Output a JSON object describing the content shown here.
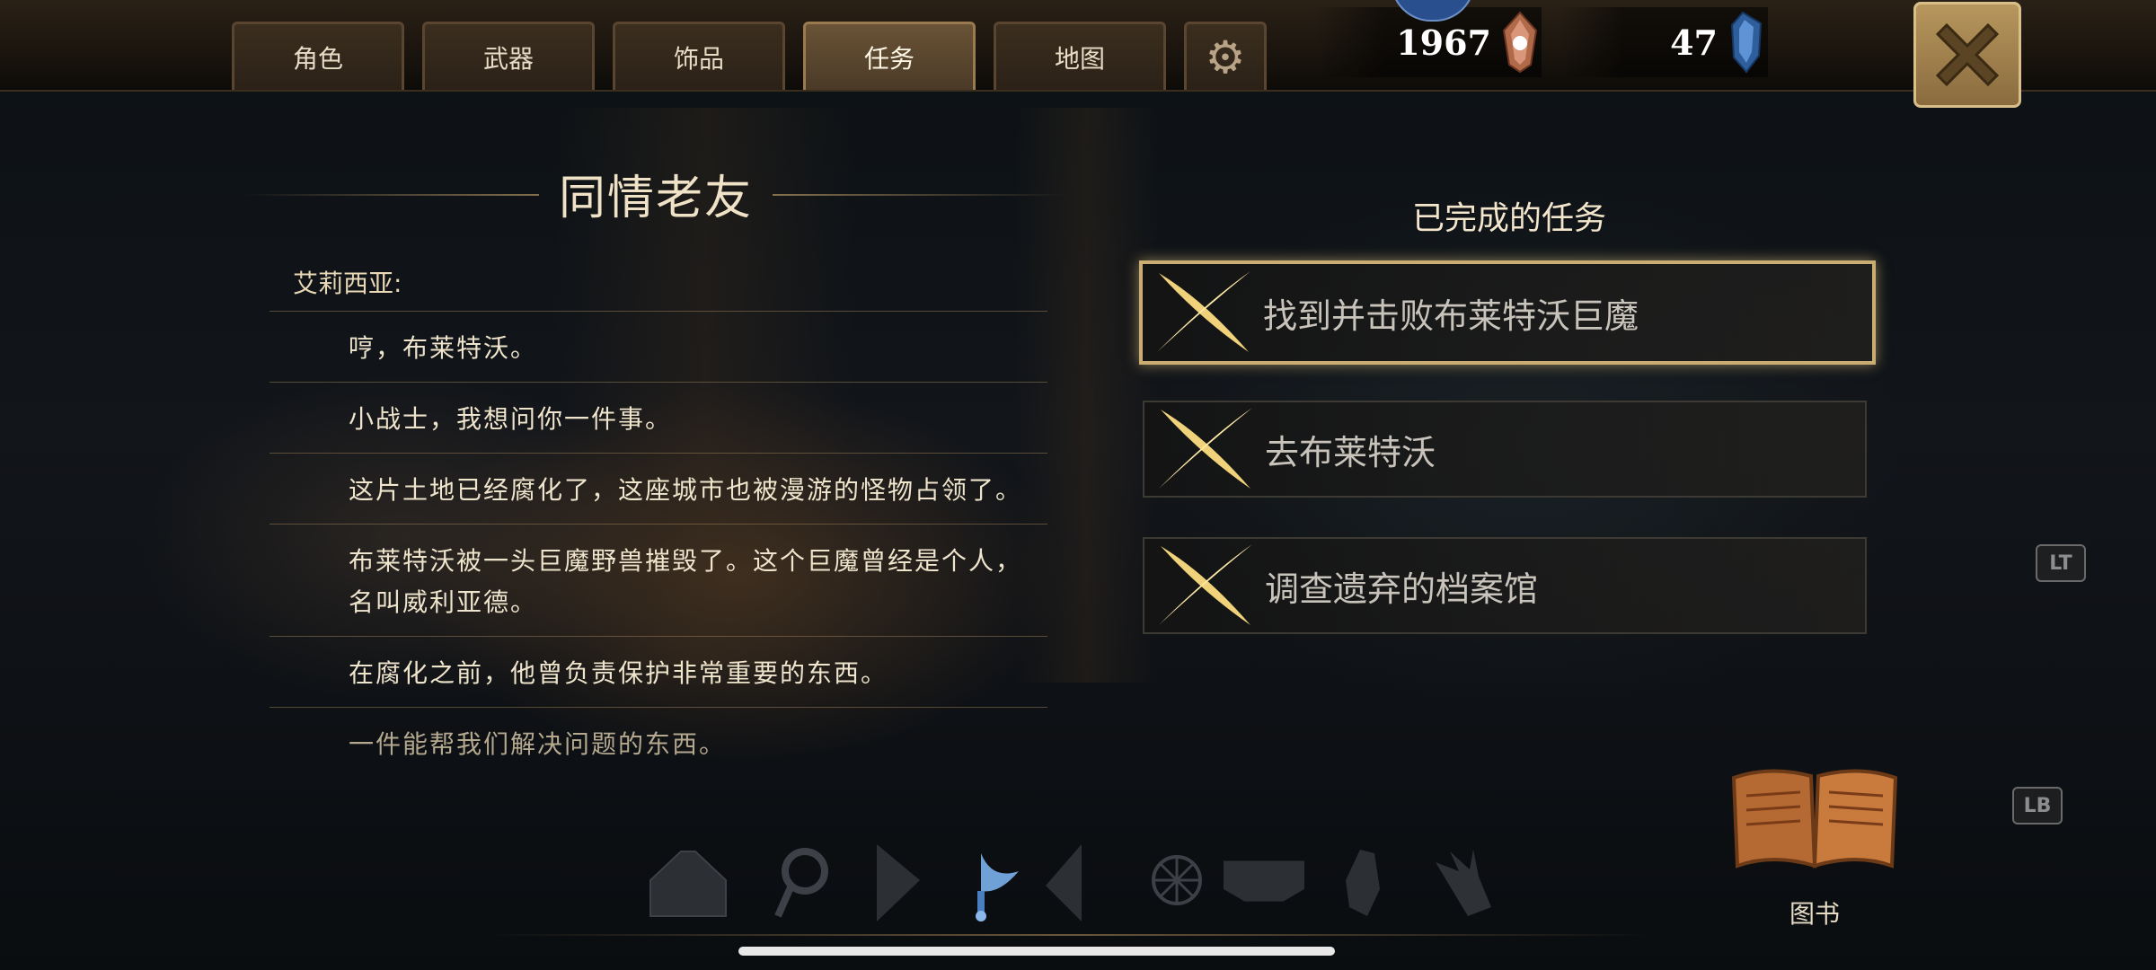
{
  "tabs": [
    {
      "label": "角色"
    },
    {
      "label": "武器"
    },
    {
      "label": "饰品"
    },
    {
      "label": "任务",
      "active": true
    },
    {
      "label": "地图"
    }
  ],
  "settings_icon": "gear-icon",
  "currency": {
    "gold": {
      "value": "1967",
      "icon": "orange-crystal-icon"
    },
    "gems": {
      "value": "47",
      "icon": "blue-crystal-icon"
    }
  },
  "close_icon": "close-icon",
  "quest": {
    "title": "同情老友",
    "speaker": "艾莉西亚:",
    "lines": [
      "哼，布莱特沃。",
      "小战士，我想问你一件事。",
      "这片土地已经腐化了，这座城市也被漫游的怪物占领了。",
      "布莱特沃被一头巨魔野兽摧毁了。这个巨魔曾经是个人，名叫威利亚德。",
      "在腐化之前，他曾负责保护非常重要的东西。",
      "一件能帮我们解决问题的东西。"
    ]
  },
  "completed": {
    "title": "已完成的任务",
    "items": [
      {
        "label": "找到并击败布莱特沃巨魔",
        "selected": true
      },
      {
        "label": "去布莱特沃"
      },
      {
        "label": "调查遗弃的档案馆"
      }
    ]
  },
  "bottom_icons": [
    "helmet-slot-icon",
    "amulet-slot-icon",
    "cape-slot-icon",
    "blue-charm-icon",
    "shield-slot-icon",
    "web-relic-icon",
    "belt-slot-icon",
    "gauntlet-slot-icon",
    "claw-relic-icon"
  ],
  "side_badges": {
    "lt": "LT",
    "lb": "LB"
  },
  "book": {
    "label": "图书",
    "icon": "book-icon"
  },
  "colors": {
    "gold_text": "#f0e2c6",
    "accent_gold": "#c9ad73",
    "background": "#0b0f12"
  }
}
